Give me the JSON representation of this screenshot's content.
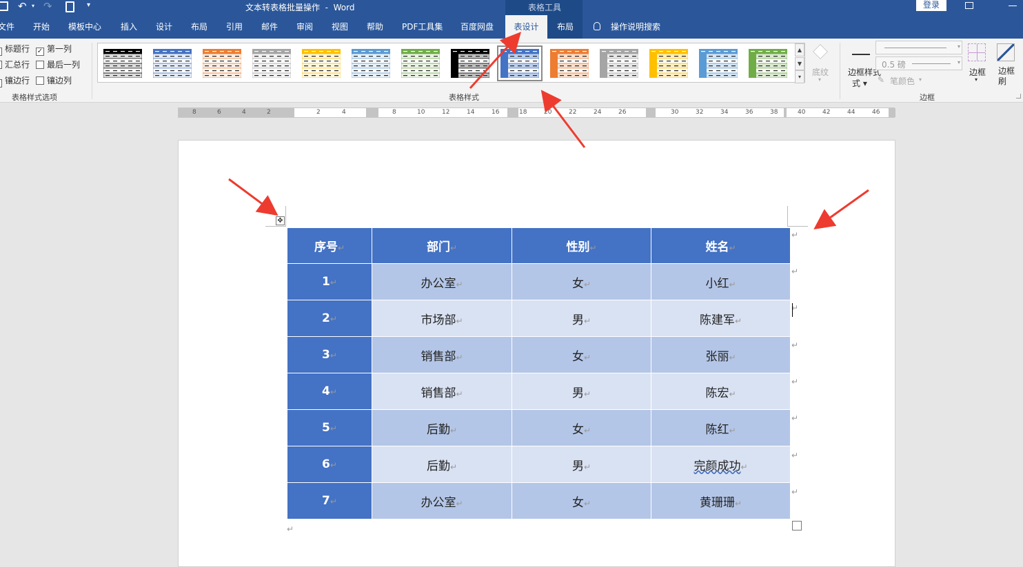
{
  "title_bar": {
    "document_title": "文本转表格批量操作  -  Word",
    "context_title": "表格工具",
    "login_label": "登录"
  },
  "tabs": [
    "文件",
    "开始",
    "模板中心",
    "插入",
    "设计",
    "布局",
    "引用",
    "邮件",
    "审阅",
    "视图",
    "帮助",
    "PDF工具集",
    "百度网盘",
    "表设计",
    "布局"
  ],
  "active_tab": "表设计",
  "tell_me": "操作说明搜索",
  "style_options": {
    "header_row": {
      "label": "标题行",
      "checked": true
    },
    "total_row": {
      "label": "汇总行",
      "checked": false
    },
    "banded_rows": {
      "label": "镶边行",
      "checked": true
    },
    "first_column": {
      "label": "第一列",
      "checked": true
    },
    "last_column": {
      "label": "最后一列",
      "checked": false
    },
    "banded_columns": {
      "label": "镶边列",
      "checked": false
    },
    "group_label": "表格样式选项"
  },
  "table_styles": {
    "group_label": "表格样式",
    "colors": [
      "#000000",
      "#4472c4",
      "#ed7d31",
      "#a5a5a5",
      "#ffc000",
      "#5b9bd5",
      "#70ad47",
      "#000000",
      "#4472c4",
      "#ed7d31",
      "#a5a5a5",
      "#ffc000",
      "#5b9bd5",
      "#70ad47"
    ],
    "shading_label": "底纹"
  },
  "borders": {
    "border_style_label": "边框样式",
    "line_weight": "0.5 磅",
    "pen_color_label": "笔颜色",
    "borders_label": "边框",
    "border_painter_label": "边框刷",
    "group_label": "边框"
  },
  "ruler": {
    "left": [
      "8",
      "6",
      "4",
      "2"
    ],
    "right": [
      "2",
      "4",
      "8",
      "10",
      "12",
      "14",
      "16",
      "18",
      "20",
      "22",
      "24",
      "26",
      "30",
      "32",
      "34",
      "36",
      "38",
      "40",
      "42",
      "44",
      "46"
    ]
  },
  "table": {
    "headers": [
      "序号",
      "部门",
      "性别",
      "姓名"
    ],
    "rows": [
      [
        "1",
        "办公室",
        "女",
        "小红"
      ],
      [
        "2",
        "市场部",
        "男",
        "陈建军"
      ],
      [
        "3",
        "销售部",
        "女",
        "张丽"
      ],
      [
        "4",
        "销售部",
        "男",
        "陈宏"
      ],
      [
        "5",
        "后勤",
        "女",
        "陈红"
      ],
      [
        "6",
        "后勤",
        "男",
        "完颜成功"
      ],
      [
        "7",
        "办公室",
        "女",
        "黄珊珊"
      ]
    ]
  }
}
